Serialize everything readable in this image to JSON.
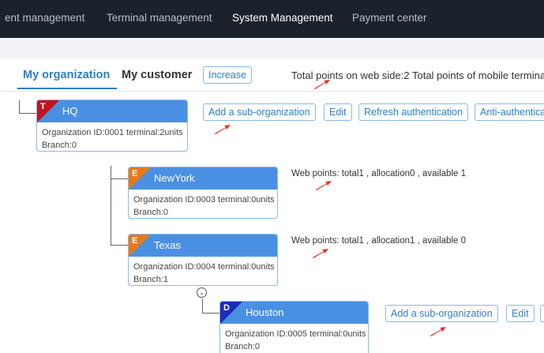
{
  "topnav": {
    "items": [
      {
        "label": "ent management"
      },
      {
        "label": "Terminal management"
      },
      {
        "label": "System Management"
      },
      {
        "label": "Payment center"
      }
    ]
  },
  "tabs": {
    "my_organization": "My organization",
    "my_customer": "My customer"
  },
  "toolbar": {
    "increase": "Increase",
    "points_total": "Total points on web side:2 Total points of mobile terminal:"
  },
  "hq_actions": {
    "add_sub": "Add a sub-organization",
    "edit": "Edit",
    "refresh": "Refresh authentication",
    "anti": "Anti-authenticat"
  },
  "houston_actions": {
    "add_sub": "Add a sub-organization",
    "edit": "Edit"
  },
  "orgs": [
    {
      "tag": "T",
      "tag_color": "#c0141b",
      "name": "HQ",
      "line1": "Organization ID:0001  terminal:2units",
      "line2": "Branch:0"
    },
    {
      "tag": "E",
      "tag_color": "#e8791a",
      "name": "NewYork",
      "line1": "Organization ID:0003  terminal:0units",
      "line2": "Branch:0",
      "points": "Web points: total1 , allocation0 , available 1"
    },
    {
      "tag": "E",
      "tag_color": "#e8791a",
      "name": "Texas",
      "line1": "Organization ID:0004  terminal:0units",
      "line2": "Branch:1",
      "points": "Web points: total1 , allocation1 , available 0"
    },
    {
      "tag": "D",
      "tag_color": "#1a2bbf",
      "name": "Houston",
      "line1": "Organization ID:0005  terminal:0units",
      "line2": "Branch:0"
    }
  ],
  "colors": {
    "accent": "#2d7fc8",
    "card_header": "#4a90e2",
    "arrow": "#e53020",
    "topnav_bg": "#1c222b"
  },
  "icons": {
    "collapse": "chevron-down-icon",
    "annotation": "red-arrow-icon"
  }
}
